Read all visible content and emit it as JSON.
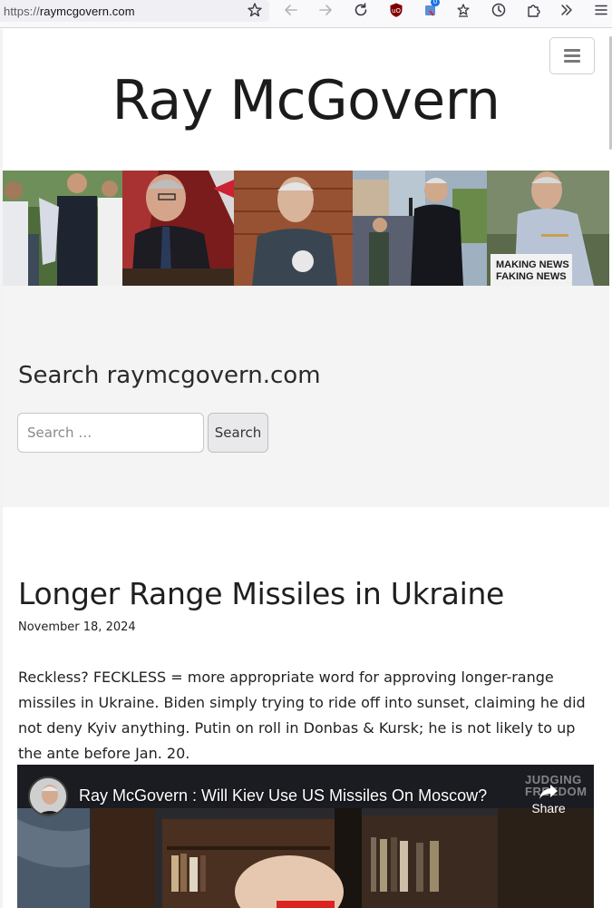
{
  "browser": {
    "url_scheme": "https://",
    "url_host": "raymcgovern.com",
    "icons": [
      "bookmark-star-icon",
      "back-arrow-icon",
      "forward-arrow-icon",
      "reload-icon",
      "ublock-icon",
      "extension-badge-icon",
      "bookmarks-toolbar-icon",
      "history-icon",
      "extensions-icon",
      "overflow-chevrons-icon",
      "app-menu-icon"
    ],
    "extension_badge": "0"
  },
  "site": {
    "title": "Ray McGovern",
    "menu_icon": "hamburger-icon",
    "banner_photos": [
      "ray-with-group-photo",
      "ray-at-flags-photo",
      "ray-veterans-for-peace-shirt-photo",
      "ray-at-rally-microphone-photo",
      "ray-making-news-faking-news-podium-photo"
    ],
    "banner_caption": "MAKING NEWS FAKING NEWS"
  },
  "search": {
    "heading": "Search raymcgovern.com",
    "placeholder": "Search …",
    "button_label": "Search"
  },
  "post": {
    "title": "Longer Range Missiles in Ukraine",
    "date": "November 18, 2024",
    "body": "Reckless? FECKLESS = more appropriate word for approving longer-range missiles in Ukraine. Biden simply trying to ride off into sunset, claiming he did not deny Kyiv anything. Putin on roll in Donbas & Kursk; he is not likely to up the ante before Jan. 20."
  },
  "video": {
    "title": "Ray McGovern : Will Kiev Use US Missiles On Moscow?",
    "share_label": "Share",
    "channel_logo": "JUDGING FREEDOM"
  },
  "colors": {
    "search_section_bg": "#f4f4f4",
    "video_bg": "#1a1a1a"
  }
}
